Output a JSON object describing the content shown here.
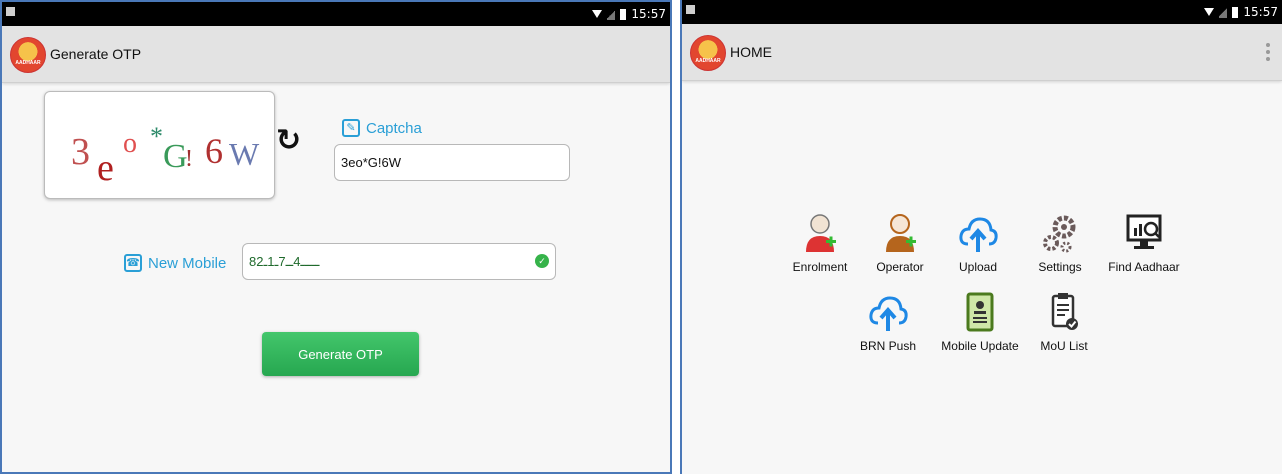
{
  "left_screen": {
    "status_time": "15:57",
    "title": "Generate OTP",
    "logo_text": "AADHAAR",
    "captcha_chars": [
      "3",
      "e",
      "o",
      "*",
      "G",
      "!",
      "6",
      "W"
    ],
    "captcha_label": "Captcha",
    "captcha_value": "3eo*G!6W",
    "mobile_label": "New Mobile",
    "mobile_value": "8ـــــ4ــ7ـ1ـ2",
    "button_label": "Generate OTP"
  },
  "right_screen": {
    "status_time": "15:57",
    "title": "HOME",
    "logo_text": "AADHAAR",
    "items": [
      {
        "label": "Enrolment",
        "icon": "enrolment-person-icon"
      },
      {
        "label": "Operator",
        "icon": "operator-person-icon"
      },
      {
        "label": "Upload",
        "icon": "cloud-upload-icon"
      },
      {
        "label": "Settings",
        "icon": "gears-icon"
      },
      {
        "label": "Find Aadhaar",
        "icon": "monitor-search-icon"
      },
      {
        "label": "BRN Push",
        "icon": "cloud-upload-icon"
      },
      {
        "label": "Mobile Update",
        "icon": "mobile-id-card-icon"
      },
      {
        "label": "MoU List",
        "icon": "clipboard-check-icon"
      }
    ]
  },
  "colors": {
    "accent_blue": "#2a9fd6",
    "button_green": "#26a750",
    "panel_border": "#4a78b8"
  }
}
